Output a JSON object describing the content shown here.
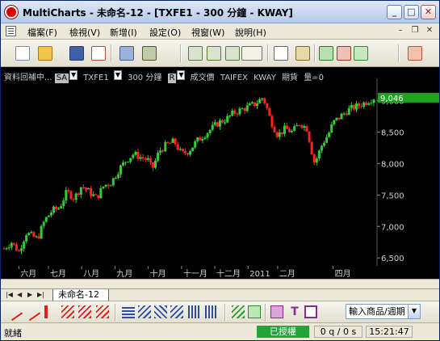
{
  "window": {
    "title": "MultiCharts - 未命名-12 - [TXFE1 - 300 分鐘 - KWAY]"
  },
  "menu": {
    "items": [
      "檔案(F)",
      "檢視(V)",
      "新增(I)",
      "設定(O)",
      "視窗(W)",
      "說明(H)"
    ]
  },
  "chart_header": {
    "status": "資料回補中...",
    "series_mode": "SA",
    "symbol": "TXFE1",
    "interval": "300 分鐘",
    "price_mode": "R",
    "price_type": "成交價",
    "exchange": "TAIFEX",
    "datafeed": "KWAY",
    "category": "期貨",
    "volume": "量=0"
  },
  "tab": {
    "label": "未命名-12"
  },
  "symbol_combo": {
    "value": "輸入商品/週期"
  },
  "status": {
    "left": "就緒",
    "connection": "已授權",
    "ticks": "0 q / 0 s",
    "time": "15:21:47"
  },
  "colors": {
    "up": "#33cc33",
    "down": "#ff2020",
    "background": "#000000",
    "axis_text": "#d0d0d0",
    "last_price_bg": "#1fa31f",
    "connected": "#22a43a"
  },
  "chart_data": {
    "type": "candlestick",
    "ylim": [
      6400,
      9250
    ],
    "y_ticks": [
      6500,
      7000,
      7500,
      8000,
      8500,
      9000
    ],
    "y_tick_labels": [
      "6,500",
      "7,000",
      "7,500",
      "8,000",
      "8,500",
      "9,000"
    ],
    "last_price": 9046,
    "last_price_label": "9,046",
    "x_ticks": [
      "六月",
      "七月",
      "八月",
      "九月",
      "十月",
      "十一月",
      "十二月",
      "2011",
      "二月",
      "四月"
    ],
    "x_tick_positions": [
      0.04,
      0.12,
      0.21,
      0.3,
      0.39,
      0.48,
      0.57,
      0.66,
      0.74,
      0.89
    ],
    "close_path": [
      [
        0.0,
        6650
      ],
      [
        0.02,
        6750
      ],
      [
        0.04,
        6600
      ],
      [
        0.06,
        6900
      ],
      [
        0.09,
        6800
      ],
      [
        0.11,
        7100
      ],
      [
        0.13,
        7250
      ],
      [
        0.15,
        7300
      ],
      [
        0.17,
        7550
      ],
      [
        0.19,
        7450
      ],
      [
        0.21,
        7650
      ],
      [
        0.23,
        7550
      ],
      [
        0.25,
        7450
      ],
      [
        0.27,
        7650
      ],
      [
        0.29,
        7700
      ],
      [
        0.31,
        7900
      ],
      [
        0.33,
        8050
      ],
      [
        0.35,
        8150
      ],
      [
        0.37,
        8100
      ],
      [
        0.39,
        8050
      ],
      [
        0.4,
        7900
      ],
      [
        0.42,
        8200
      ],
      [
        0.44,
        8300
      ],
      [
        0.46,
        8350
      ],
      [
        0.48,
        8150
      ],
      [
        0.5,
        8200
      ],
      [
        0.52,
        8350
      ],
      [
        0.54,
        8450
      ],
      [
        0.56,
        8550
      ],
      [
        0.58,
        8650
      ],
      [
        0.6,
        8700
      ],
      [
        0.62,
        8800
      ],
      [
        0.64,
        8850
      ],
      [
        0.66,
        8900
      ],
      [
        0.68,
        8950
      ],
      [
        0.7,
        9050
      ],
      [
        0.71,
        8900
      ],
      [
        0.72,
        8700
      ],
      [
        0.74,
        8450
      ],
      [
        0.76,
        8550
      ],
      [
        0.78,
        8500
      ],
      [
        0.8,
        8650
      ],
      [
        0.82,
        8550
      ],
      [
        0.83,
        8250
      ],
      [
        0.84,
        8000
      ],
      [
        0.86,
        8300
      ],
      [
        0.88,
        8500
      ],
      [
        0.89,
        8650
      ],
      [
        0.91,
        8750
      ],
      [
        0.93,
        8850
      ],
      [
        0.95,
        8900
      ],
      [
        0.97,
        8950
      ],
      [
        1.0,
        9046
      ]
    ]
  }
}
